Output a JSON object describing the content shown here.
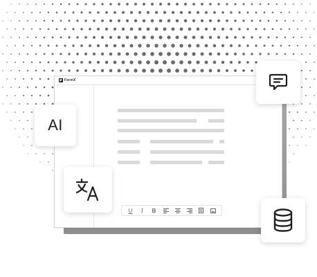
{
  "app": {
    "title": "FormX",
    "logo_icon": "formx-logo-icon"
  },
  "editor": {
    "toolbar": [
      {
        "name": "underline",
        "glyph": "U",
        "icon": "underline-icon"
      },
      {
        "name": "italic",
        "glyph": "I",
        "icon": "italic-icon"
      },
      {
        "name": "bold",
        "glyph": "B",
        "icon": "bold-icon"
      },
      {
        "name": "align-left",
        "icon": "align-left-icon"
      },
      {
        "name": "align-center",
        "icon": "align-center-icon"
      },
      {
        "name": "align-right",
        "icon": "align-right-icon"
      },
      {
        "name": "document",
        "icon": "document-icon"
      },
      {
        "name": "image",
        "icon": "image-icon"
      }
    ]
  },
  "cards": {
    "ai": {
      "label": "AI"
    },
    "translate": {
      "icon": "translate-icon"
    },
    "comment": {
      "icon": "comment-icon"
    },
    "database": {
      "icon": "database-icon"
    }
  },
  "colors": {
    "text_line": "#d9d9d9",
    "window_shadow": "#9a9a9a",
    "dot": "#6b6b6b",
    "icon": "#1f1f1f"
  }
}
